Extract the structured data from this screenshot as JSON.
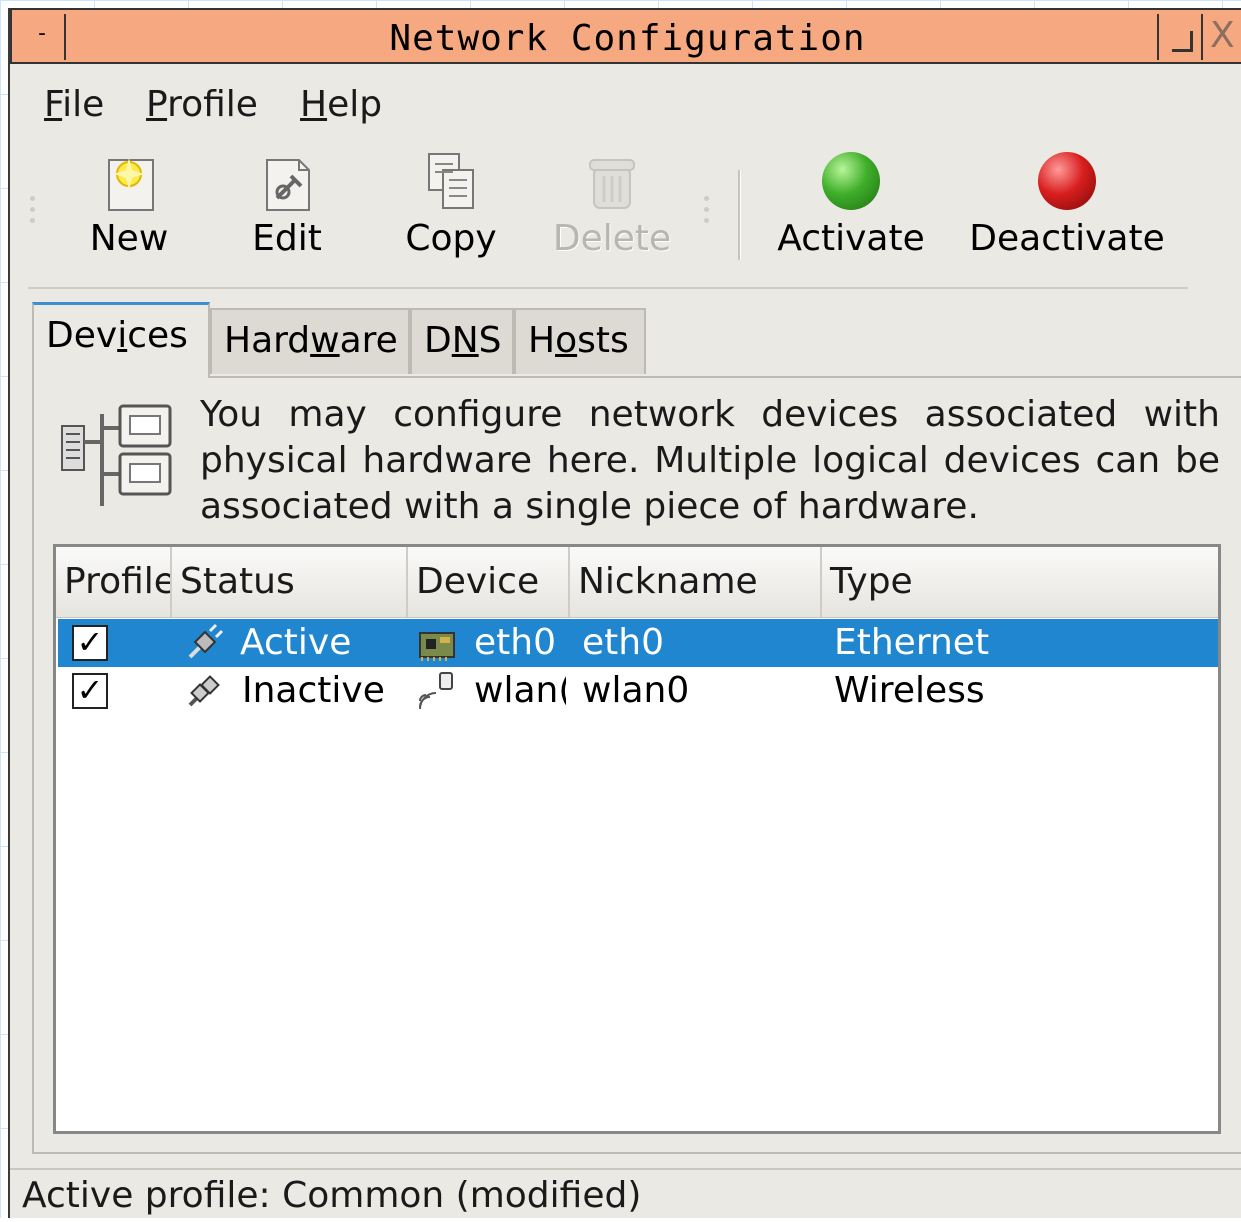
{
  "window": {
    "title": "Network Configuration",
    "menu_glyph": "-",
    "close_glyph": "X"
  },
  "menubar": {
    "items": [
      {
        "label_u": "F",
        "label_rest": "ile"
      },
      {
        "label_u": "P",
        "label_rest": "rofile"
      },
      {
        "label_u": "H",
        "label_rest": "elp"
      }
    ]
  },
  "toolbar": {
    "new_label": "New",
    "edit_label": "Edit",
    "copy_label": "Copy",
    "delete_label": "Delete",
    "activate_label": "Activate",
    "deactivate_label": "Deactivate",
    "colors": {
      "activate": "#3fae2a",
      "deactivate": "#d81e1e"
    }
  },
  "tabs": [
    {
      "pre": "Dev",
      "u": "i",
      "post": "ces",
      "active": true
    },
    {
      "pre": "Hard",
      "u": "w",
      "post": "are",
      "active": false
    },
    {
      "pre": "D",
      "u": "N",
      "post": "S",
      "active": false
    },
    {
      "pre": "H",
      "u": "o",
      "post": "sts",
      "active": false
    }
  ],
  "devices_tab": {
    "description": "You may configure network devices associated with physical hardware here.  Multiple logical devices can be associated with a single piece of hardware."
  },
  "table": {
    "columns": [
      "Profile",
      "Status",
      "Device",
      "Nickname",
      "Type"
    ],
    "rows": [
      {
        "profile": "✓",
        "status": "Active",
        "device": "eth0",
        "nickname": "eth0",
        "type": "Ethernet",
        "selected": true
      },
      {
        "profile": "✓",
        "status": "Inactive",
        "device": "wlan(",
        "nickname": "wlan0",
        "type": "Wireless",
        "selected": false
      }
    ]
  },
  "statusbar": {
    "text": "Active profile: Common (modified)"
  },
  "colors": {
    "titlebar": "#f6a981",
    "selection": "#1f86cf",
    "tab_accent": "#3d8fd0"
  }
}
